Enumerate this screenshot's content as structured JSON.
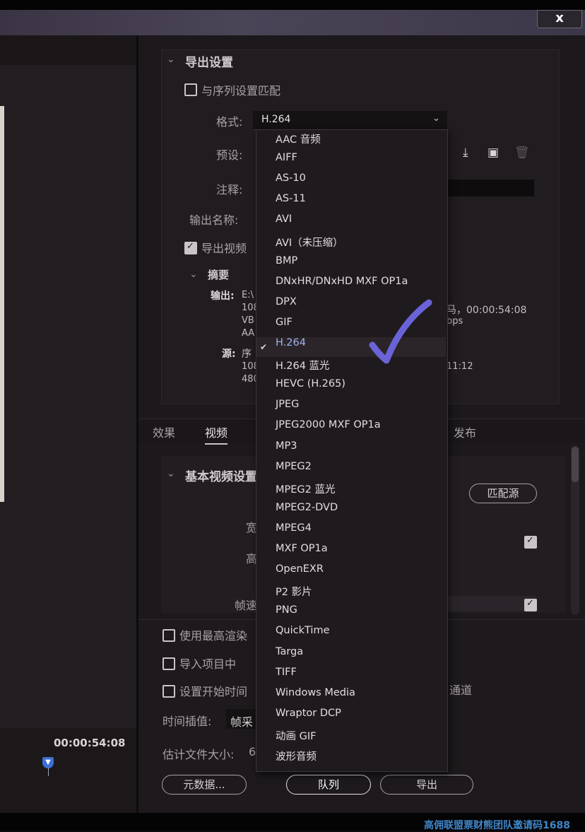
{
  "window": {
    "close_glyph": "x"
  },
  "left": {
    "timecode": "00:00:54:08"
  },
  "export_settings": {
    "section_title": "导出设置",
    "match_sequence_label": "与序列设置匹配",
    "format_label": "格式:",
    "format_value": "H.264",
    "preset_label": "预设:",
    "comments_label": "注释:",
    "output_name_label": "输出名称:",
    "export_video_label": "导出视频",
    "summary_title": "摘要",
    "output_label": "输出:",
    "output_lines": [
      "E:\\",
      "108",
      "VB",
      "AA"
    ],
    "output_right_1": "马，00:00:54:08",
    "output_right_2": "bps",
    "source_label": "源:",
    "source_lines": [
      "序",
      "108",
      "480"
    ],
    "source_right": "11:12"
  },
  "tabs": {
    "effects": "效果",
    "video": "视频",
    "publish": "发布"
  },
  "basic_video": {
    "title": "基本视频设置",
    "match_source_btn": "匹配源",
    "width_label": "宽",
    "height_label": "高",
    "frame_rate_label": "帧速"
  },
  "bottom": {
    "max_render_label": "使用最高渲染",
    "import_project_label": "导入项目中",
    "set_start_label": "设置开始时间",
    "channel_fragment": "通道",
    "time_interp_label": "时间插值:",
    "time_interp_value": "帧采",
    "est_size_label": "估计文件大小:",
    "est_size_value": "6",
    "metadata_btn": "元数据...",
    "queue_btn": "队列",
    "export_btn": "导出"
  },
  "format_options": [
    "AAC 音频",
    "AIFF",
    "AS-10",
    "AS-11",
    "AVI",
    "AVI（未压缩）",
    "BMP",
    "DNxHR/DNxHD MXF OP1a",
    "DPX",
    "GIF",
    "H.264",
    "H.264 蓝光",
    "HEVC (H.265)",
    "JPEG",
    "JPEG2000 MXF OP1a",
    "MP3",
    "MPEG2",
    "MPEG2 蓝光",
    "MPEG2-DVD",
    "MPEG4",
    "MXF OP1a",
    "OpenEXR",
    "P2 影片",
    "PNG",
    "QuickTime",
    "Targa",
    "TIFF",
    "Windows Media",
    "Wraptor DCP",
    "动画 GIF",
    "波形音频"
  ],
  "selected_format": "H.264",
  "annotation": {
    "color": "#6a63d8"
  },
  "watermark": "高佣联盟票财熊团队邀请码1688"
}
